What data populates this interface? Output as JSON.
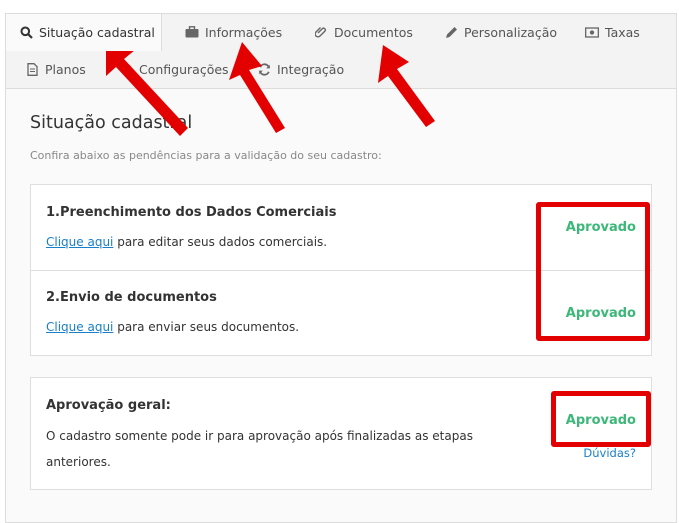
{
  "tabs": [
    {
      "label": "Situação cadastral",
      "icon": "search-icon"
    },
    {
      "label": "Informações",
      "icon": "briefcase-icon"
    },
    {
      "label": "Documentos",
      "icon": "paperclip-icon"
    },
    {
      "label": "Personalização",
      "icon": "pencil-icon"
    },
    {
      "label": "Taxas",
      "icon": "money-icon"
    },
    {
      "label": "Planos",
      "icon": "file-icon"
    },
    {
      "label": "Configurações",
      "icon": "gear-icon"
    },
    {
      "label": "Integração",
      "icon": "refresh-icon"
    }
  ],
  "main": {
    "title": "Situação cadastral",
    "subtitle": "Confira abaixo as pendências para a validação do seu cadastro:"
  },
  "steps": [
    {
      "title": "1.Preenchimento dos Dados Comerciais",
      "link": "Clique aqui",
      "text": " para editar seus dados comerciais.",
      "status": "Aprovado"
    },
    {
      "title": "2.Envio de documentos",
      "link": "Clique aqui",
      "text": " para enviar seus documentos.",
      "status": "Aprovado"
    }
  ],
  "overall": {
    "title": "Aprovação geral:",
    "text_line1": "O cadastro somente pode ir para aprovação após finalizadas as etapas",
    "text_line2": "anteriores.",
    "status": "Aprovado",
    "help_link": "Dúvidas?"
  },
  "colors": {
    "approved": "#3cb878",
    "link": "#1a7fc9",
    "annotation": "#e30000"
  }
}
